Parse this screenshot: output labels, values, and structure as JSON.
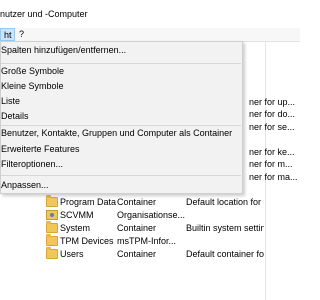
{
  "window": {
    "title": "nutzer und -Computer"
  },
  "menubar": {
    "active_label": "ht",
    "help_label": "?"
  },
  "dropdown": {
    "items": [
      "Spalten hinzufügen/entfernen...",
      "Große Symbole",
      "Kleine Symbole",
      "Liste",
      "Details",
      "Benutzer, Kontakte, Gruppen und Computer als Container",
      "Erweiterte Features",
      "Filteroptionen...",
      "Anpassen..."
    ]
  },
  "list": {
    "partial_rows": [
      "ner for up...",
      "ner for do...",
      "ner for se...",
      "ner for ke...",
      "ner for m...",
      "ner for ma..."
    ],
    "rows": [
      {
        "name": "Program Data",
        "type": "Container",
        "description": "Default location for stor...",
        "icon": "folder-icon"
      },
      {
        "name": "SCVMM",
        "type": "Organisationse...",
        "description": "",
        "icon": "ou-icon"
      },
      {
        "name": "System",
        "type": "Container",
        "description": "Builtin system settings",
        "icon": "folder-icon"
      },
      {
        "name": "TPM Devices",
        "type": "msTPM-Infor...",
        "description": "",
        "icon": "folder-icon"
      },
      {
        "name": "Users",
        "type": "Container",
        "description": "Default container for up...",
        "icon": "folder-icon"
      }
    ]
  }
}
